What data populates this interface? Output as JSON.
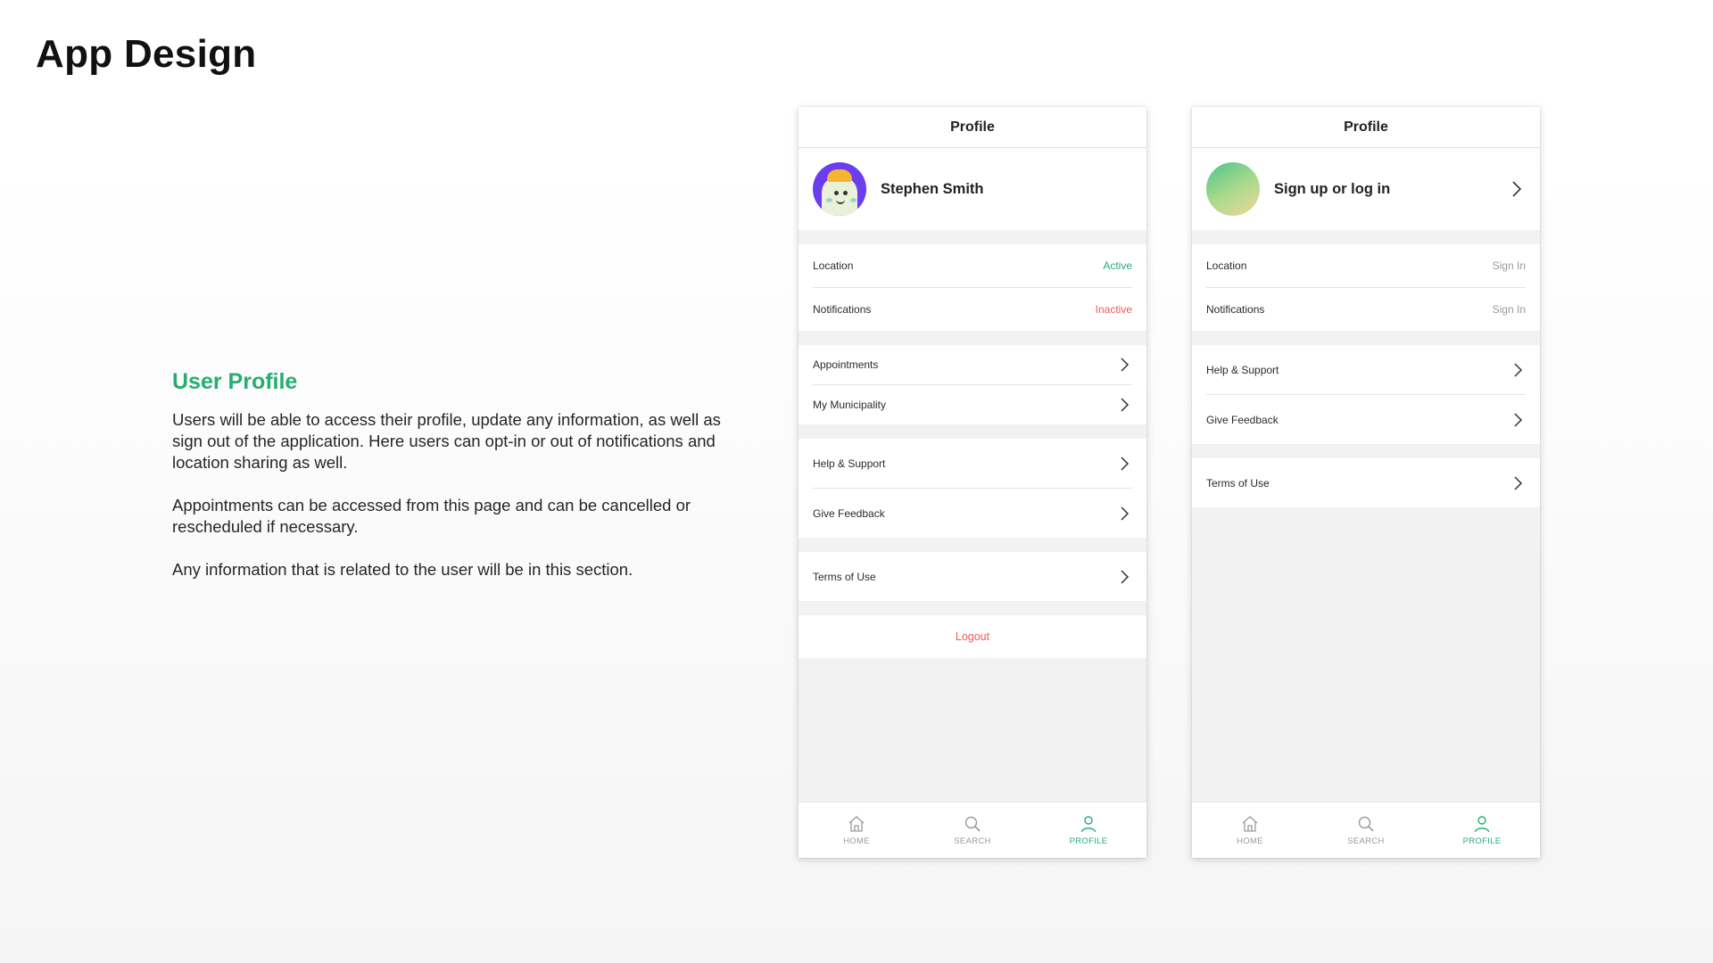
{
  "page": {
    "title": "App Design"
  },
  "intro": {
    "heading": "User Profile",
    "paragraphs": [
      "Users will be able to access their profile, update any information, as well as sign out of the application. Here users can opt-in or out of notifications and location sharing as well.",
      "Appointments can be accessed from this page and can be cancelled or rescheduled if necessary.",
      "Any information that is related to the user will be in this section."
    ]
  },
  "colors": {
    "accent": "#25ad74",
    "danger": "#f05a5a",
    "muted": "#9a9a9a",
    "avatar_bg": "#6a3df0"
  },
  "screen1": {
    "header": "Profile",
    "user_name": "Stephen Smith",
    "settings": [
      {
        "label": "Location",
        "status": "Active"
      },
      {
        "label": "Notifications",
        "status": "Inactive"
      }
    ],
    "group1": [
      "Appointments",
      "My Municipality"
    ],
    "group2": [
      "Help & Support",
      "Give Feedback"
    ],
    "group3": [
      "Terms of Use"
    ],
    "logout": "Logout"
  },
  "screen2": {
    "header": "Profile",
    "cta": "Sign up or log in",
    "settings": [
      {
        "label": "Location",
        "status": "Sign In"
      },
      {
        "label": "Notifications",
        "status": "Sign In"
      }
    ],
    "group1": [
      "Help & Support",
      "Give Feedback"
    ],
    "group2": [
      "Terms of Use"
    ]
  },
  "tabbar": {
    "items": [
      {
        "label": "HOME",
        "icon": "home-icon",
        "active": false
      },
      {
        "label": "SEARCH",
        "icon": "search-icon",
        "active": false
      },
      {
        "label": "PROFILE",
        "icon": "profile-icon",
        "active": true
      }
    ]
  }
}
